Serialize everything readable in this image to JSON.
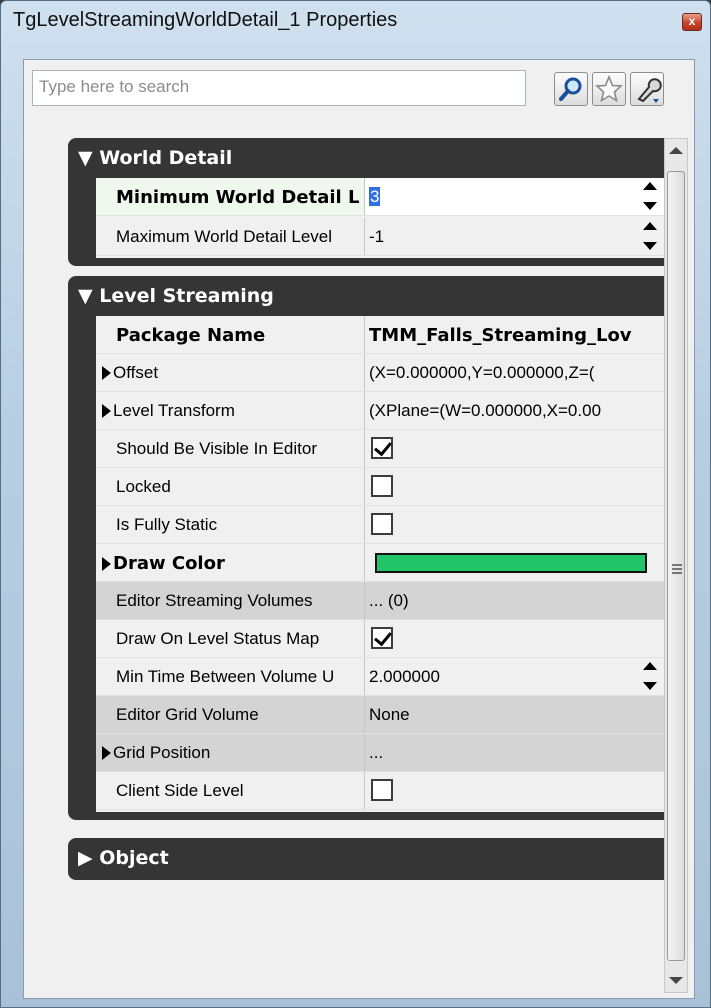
{
  "window": {
    "title": "TgLevelStreamingWorldDetail_1 Properties",
    "close_glyph": "x"
  },
  "toolbar": {
    "search_placeholder": "Type here to search",
    "icons": [
      "search-icon",
      "favorite-star-icon",
      "settings-wrench-icon"
    ]
  },
  "categories": {
    "world_detail": {
      "label": "▼ World Detail",
      "rows": [
        {
          "name": "Minimum World Detail L",
          "value": "3"
        },
        {
          "name": "Maximum World Detail Level",
          "value": "-1"
        }
      ]
    },
    "level_streaming": {
      "label": "▼ Level Streaming",
      "rows": [
        {
          "name": "Package Name",
          "value": "TMM_Falls_Streaming_Lov"
        },
        {
          "name": "Offset",
          "value": "(X=0.000000,Y=0.000000,Z=("
        },
        {
          "name": "Level Transform",
          "value": "(XPlane=(W=0.000000,X=0.00"
        },
        {
          "name": "Should Be Visible In Editor",
          "checked": true
        },
        {
          "name": "Locked",
          "checked": false
        },
        {
          "name": "Is Fully Static",
          "checked": false
        },
        {
          "name": "Draw Color",
          "color": "#22c46a"
        },
        {
          "name": "Editor Streaming Volumes",
          "value": "... (0)"
        },
        {
          "name": "Draw On Level Status Map",
          "checked": true
        },
        {
          "name": "Min Time Between Volume U",
          "value": "2.000000"
        },
        {
          "name": "Editor Grid Volume",
          "value": "None"
        },
        {
          "name": "Grid Position",
          "value": "..."
        },
        {
          "name": "Client Side Level",
          "checked": false
        }
      ]
    },
    "object": {
      "label": "▶ Object"
    }
  },
  "colors": {
    "category_header": "#353535",
    "shaded_row": "#d4d4d4",
    "draw_color": "#22c46a"
  }
}
